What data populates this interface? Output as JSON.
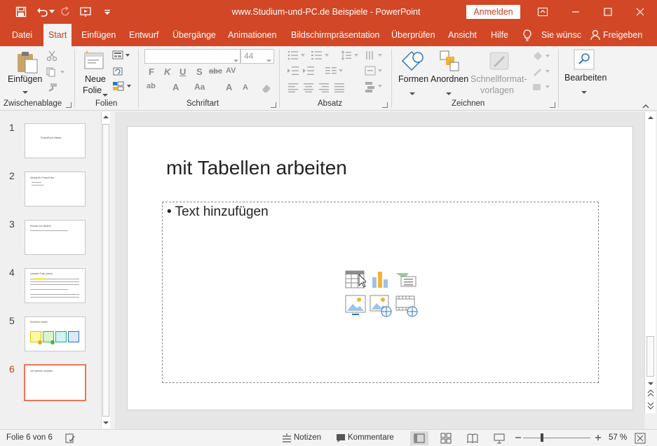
{
  "title_bar": {
    "title": "www.Studium-und-PC.de Beispiele  -  PowerPoint",
    "signin_label": "Anmelden"
  },
  "tabs": [
    "Datei",
    "Start",
    "Einfügen",
    "Entwurf",
    "Übergänge",
    "Animationen",
    "Bildschirmpräsentation",
    "Überprüfen",
    "Ansicht",
    "Hilfe"
  ],
  "active_tab": "Start",
  "tell_me": "Sie wünsc",
  "share_label": "Freigeben",
  "ribbon": {
    "clipboard": {
      "paste_label": "Einfügen",
      "group_label": "Zwischenablage"
    },
    "slides": {
      "new_slide_label_1": "Neue",
      "new_slide_label_2": "Folie",
      "group_label": "Folien"
    },
    "font": {
      "font_name": "",
      "font_size": "44",
      "group_label": "Schriftart"
    },
    "paragraph": {
      "group_label": "Absatz"
    },
    "drawing": {
      "shapes_label": "Formen",
      "arrange_label": "Anordnen",
      "quickstyles_label_1": "Schnellformat-",
      "quickstyles_label_2": "vorlagen",
      "group_label": "Zeichnen"
    },
    "editing": {
      "edit_label": "Bearbeiten"
    }
  },
  "thumbnails": [
    {
      "number": "1",
      "text": "PowerPoint effektiv"
    },
    {
      "number": "2",
      "text": "Übung für PowerPoint"
    },
    {
      "number": "3",
      "text": "Einsatz von Bildern"
    },
    {
      "number": "4",
      "text": "Lesbare Folie (oben)"
    },
    {
      "number": "5",
      "text": "SmartArt nutzen"
    },
    {
      "number": "6",
      "text": "mit Tabellen arbeiten"
    }
  ],
  "active_slide": 6,
  "slide": {
    "title": "mit Tabellen arbeiten",
    "bullet": "• Text hinzufügen"
  },
  "status_bar": {
    "slide_info": "Folie 6 von 6",
    "notes_label": "Notizen",
    "comments_label": "Kommentare",
    "zoom_level": "57 %"
  },
  "colors": {
    "accent": "#d24726",
    "active_text": "#c43e1c"
  }
}
